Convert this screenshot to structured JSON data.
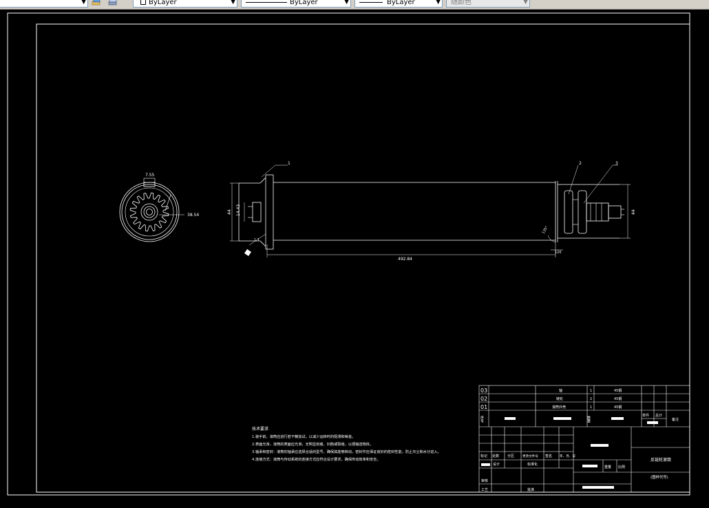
{
  "toolbar": {
    "layer_dropdown_value": "ByLayer",
    "linetype_dropdown_value": "ByLayer",
    "lineweight_dropdown_value": "ByLayer",
    "plotstyle_dropdown_value": "随颜色"
  },
  "drawing": {
    "dim_top_left": "7.55",
    "dim_bolt_circle": "38.54",
    "dim_shaft_left": "44",
    "dim_inner_left": "14.43",
    "dim_overall_length": "492.84",
    "dim_right_diameter": "44",
    "dim_right_end": "120",
    "dim_chamfer_left": "1.1",
    "dim_chamfer_right": "135°",
    "balloon_1": "1",
    "balloon_2": "2",
    "balloon_3": "3",
    "notes_title": "技术要求",
    "notes_lines": [
      "1.装手前，滚筒应进行若干精加试，以减少运转时的阻滞和噪音。",
      "2.表面光滑，滚筒的表面应光滑，无明显划痕、凹陷或裂缝，以便输送物体。",
      "3.轴承和密封：滚筒的轴承应选择合适的型号，确保其能够转动，密封件应保证良好的密封性能，防止灰尘和水分进入。",
      "4.连接方式：滚筒与传动系统的连接方式应符合设计要求，确保传动效率和安全。"
    ]
  },
  "title_block": {
    "parts": [
      {
        "no": "03",
        "name": "轴",
        "qty": "1",
        "material": "45钢"
      },
      {
        "no": "02",
        "name": "链轮",
        "qty": "2",
        "material": "45钢"
      },
      {
        "no": "01",
        "name": "滚筒外壳",
        "qty": "1",
        "material": "45钢"
      }
    ],
    "hdr_seq": "序号",
    "hdr_qty": "数量",
    "hdr_single": "单件",
    "hdr_total": "总计",
    "hdr_remark": "备注",
    "row_labels": [
      "标记",
      "处数",
      "分区",
      "更改文件号",
      "签名",
      "年、月、日"
    ],
    "designer": "设计",
    "standardize": "标准化",
    "reviewer": "审核",
    "craft": "工艺",
    "approve": "批准",
    "weight": "重量",
    "ratio": "比例",
    "drawing_name": "反链轮滚筒",
    "drawing_code": "(图样代号)"
  }
}
